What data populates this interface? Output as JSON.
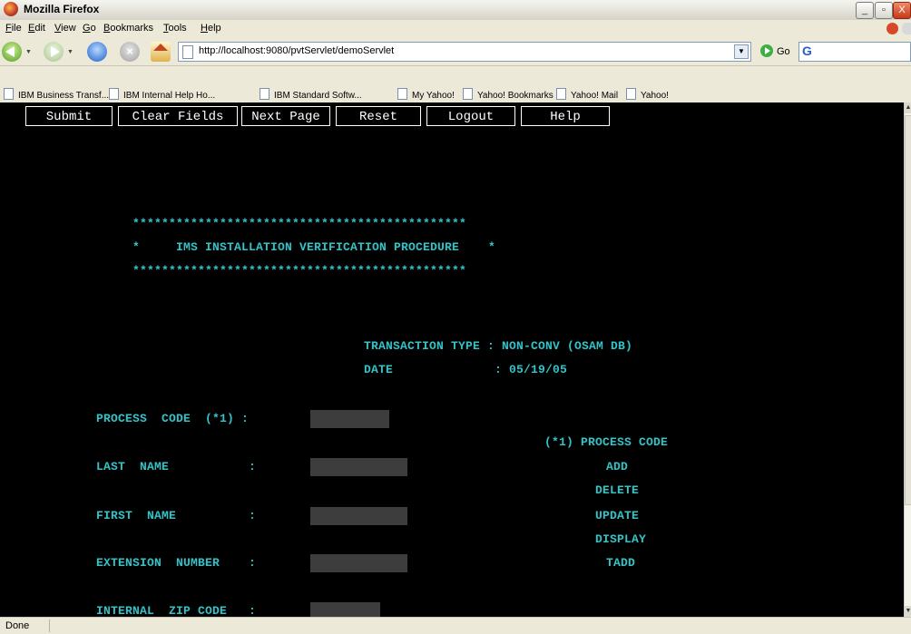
{
  "window": {
    "title": "Mozilla Firefox",
    "controls": [
      "_",
      "▫",
      "X"
    ]
  },
  "menubar": {
    "items": [
      "File",
      "Edit",
      "View",
      "Go",
      "Bookmarks",
      "Tools",
      "Help"
    ]
  },
  "navbar": {
    "url": "http://localhost:9080/pvtServlet/demoServlet",
    "go_label": "Go",
    "search_engine_icon": "G"
  },
  "bookmarks": [
    "IBM Business Transf...",
    "IBM Internal Help Ho...",
    "IBM Standard Softw...",
    "My Yahoo!",
    "Yahoo! Bookmarks",
    "Yahoo! Mail",
    "Yahoo!"
  ],
  "page": {
    "buttons": [
      "Submit",
      "Clear Fields",
      "Next Page",
      "Reset",
      "Logout",
      "Help"
    ],
    "banner": {
      "line1": "**********************************************",
      "line2": "*     IMS INSTALLATION VERIFICATION PROCEDURE    *",
      "line3": "**********************************************"
    },
    "transaction_type": "TRANSACTION TYPE : NON-CONV (OSAM DB)",
    "date": "DATE              : 05/19/05",
    "fields": [
      {
        "label": "PROCESS  CODE  (*1) :",
        "value": ""
      },
      {
        "label": "LAST  NAME           :",
        "value": ""
      },
      {
        "label": "FIRST  NAME          :",
        "value": ""
      },
      {
        "label": "EXTENSION  NUMBER    :",
        "value": ""
      },
      {
        "label": "INTERNAL  ZIP CODE   :",
        "value": ""
      }
    ],
    "process_code_title": "(*1) PROCESS CODE",
    "process_codes": [
      "ADD",
      "DELETE",
      "UPDATE",
      "DISPLAY",
      "TADD"
    ]
  },
  "status": "Done",
  "colors": {
    "terminal_text": "#32c4c8",
    "terminal_bg": "#000000",
    "field_bg": "#3d3d3d"
  }
}
